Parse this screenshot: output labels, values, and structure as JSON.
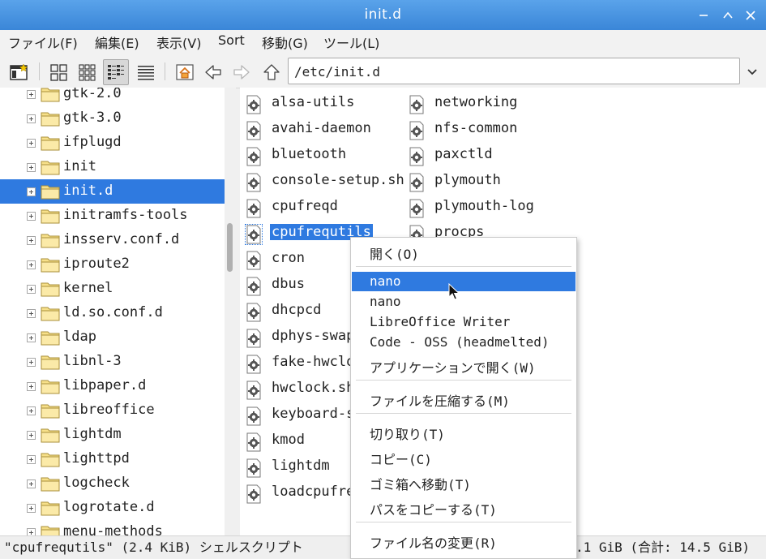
{
  "window": {
    "title": "init.d"
  },
  "menubar": [
    "ファイル(F)",
    "編集(E)",
    "表示(V)",
    "Sort",
    "移動(G)",
    "ツール(L)"
  ],
  "path": {
    "value": "/etc/init.d"
  },
  "tree": {
    "items": [
      {
        "label": "gtk-2.0"
      },
      {
        "label": "gtk-3.0"
      },
      {
        "label": "ifplugd"
      },
      {
        "label": "init"
      },
      {
        "label": "init.d",
        "selected": true
      },
      {
        "label": "initramfs-tools"
      },
      {
        "label": "insserv.conf.d"
      },
      {
        "label": "iproute2"
      },
      {
        "label": "kernel"
      },
      {
        "label": "ld.so.conf.d"
      },
      {
        "label": "ldap"
      },
      {
        "label": "libnl-3"
      },
      {
        "label": "libpaper.d"
      },
      {
        "label": "libreoffice"
      },
      {
        "label": "lightdm"
      },
      {
        "label": "lighttpd"
      },
      {
        "label": "logcheck"
      },
      {
        "label": "logrotate.d"
      },
      {
        "label": "menu-methods"
      }
    ]
  },
  "files": {
    "col1": [
      "alsa-utils",
      "avahi-daemon",
      "bluetooth",
      "console-setup.sh",
      "cpufreqd",
      "cpufrequtils",
      "cron",
      "dbus",
      "dhcpcd",
      "dphys-swapf",
      "fake-hwcloc",
      "hwclock.sh",
      "keyboard-se",
      "kmod",
      "lightdm",
      "loadcpufreq"
    ],
    "col2": [
      "networking",
      "nfs-common",
      "paxctld",
      "plymouth",
      "plymouth-log",
      "procps"
    ],
    "selected": "cpufrequtils"
  },
  "context_menu": {
    "items": [
      {
        "label": "開く(O)"
      },
      {
        "sep": true
      },
      {
        "label": "nano",
        "highlighted": true
      },
      {
        "label": "nano"
      },
      {
        "label": "LibreOffice Writer"
      },
      {
        "label": "Code - OSS (headmelted)"
      },
      {
        "label": "アプリケーションで開く(W)"
      },
      {
        "sep": true
      },
      {
        "label": "ファイルを圧縮する(M)"
      },
      {
        "sep": true
      },
      {
        "label": "切り取り(T)"
      },
      {
        "label": "コピー(C)"
      },
      {
        "label": "ゴミ箱へ移動(T)"
      },
      {
        "label": "パスをコピーする(T)"
      },
      {
        "sep": true
      },
      {
        "label": "ファイル名の変更(R)"
      }
    ]
  },
  "status": {
    "left": "\"cpufrequtils\" (2.4 KiB) シェルスクリプト",
    "right": ".1 GiB (合計: 14.5 GiB)"
  },
  "colors": {
    "selection": "#2f7ae0",
    "titlebar": "#4a95e2",
    "folder": "#f7e08a"
  }
}
